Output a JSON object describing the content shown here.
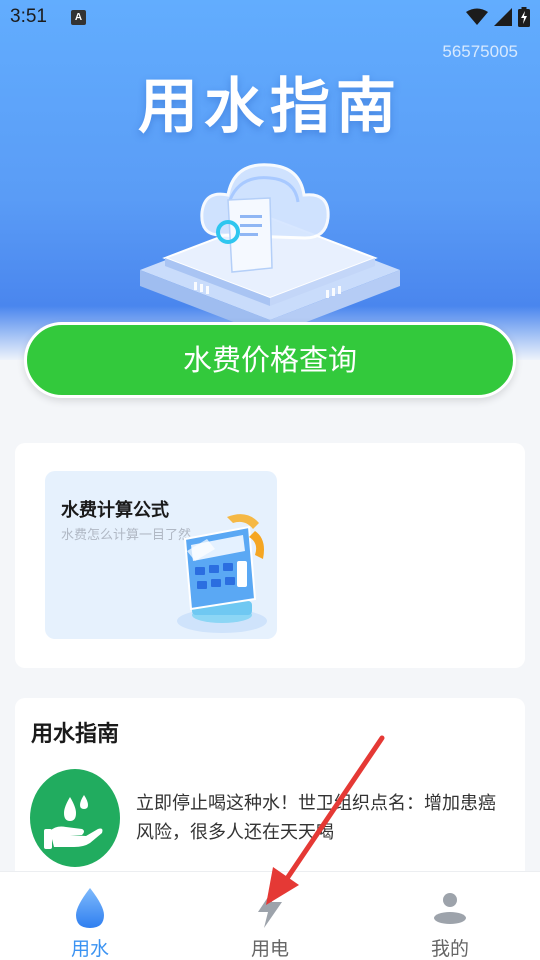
{
  "status_bar": {
    "time": "3:51",
    "notification_icon": "a-icon",
    "icons": [
      "wifi-icon",
      "signal-icon",
      "battery-icon"
    ]
  },
  "header": {
    "app_id": "56575005",
    "title": "用水指南"
  },
  "price_query_button": "水费价格查询",
  "formula_card": {
    "title": "水费计算公式",
    "subtitle": "水费怎么计算一目了然"
  },
  "guide_section": {
    "title": "用水指南",
    "article": {
      "icon": "water-hand-icon",
      "text": "立即停止喝这种水！世卫组织点名：增加患癌风险，很多人还在天天喝"
    }
  },
  "bottom_nav": {
    "items": [
      {
        "label": "用水",
        "icon": "water-drop-icon",
        "active": true
      },
      {
        "label": "用电",
        "icon": "lightning-icon",
        "active": false
      },
      {
        "label": "我的",
        "icon": "person-icon",
        "active": false
      }
    ]
  },
  "colors": {
    "hero_blue": "#5a9cf6",
    "primary_green": "#33c93c",
    "guide_green": "#21ac5f",
    "nav_active": "#3b93f2",
    "nav_inactive": "#666666",
    "annotation_red": "#e53935"
  }
}
